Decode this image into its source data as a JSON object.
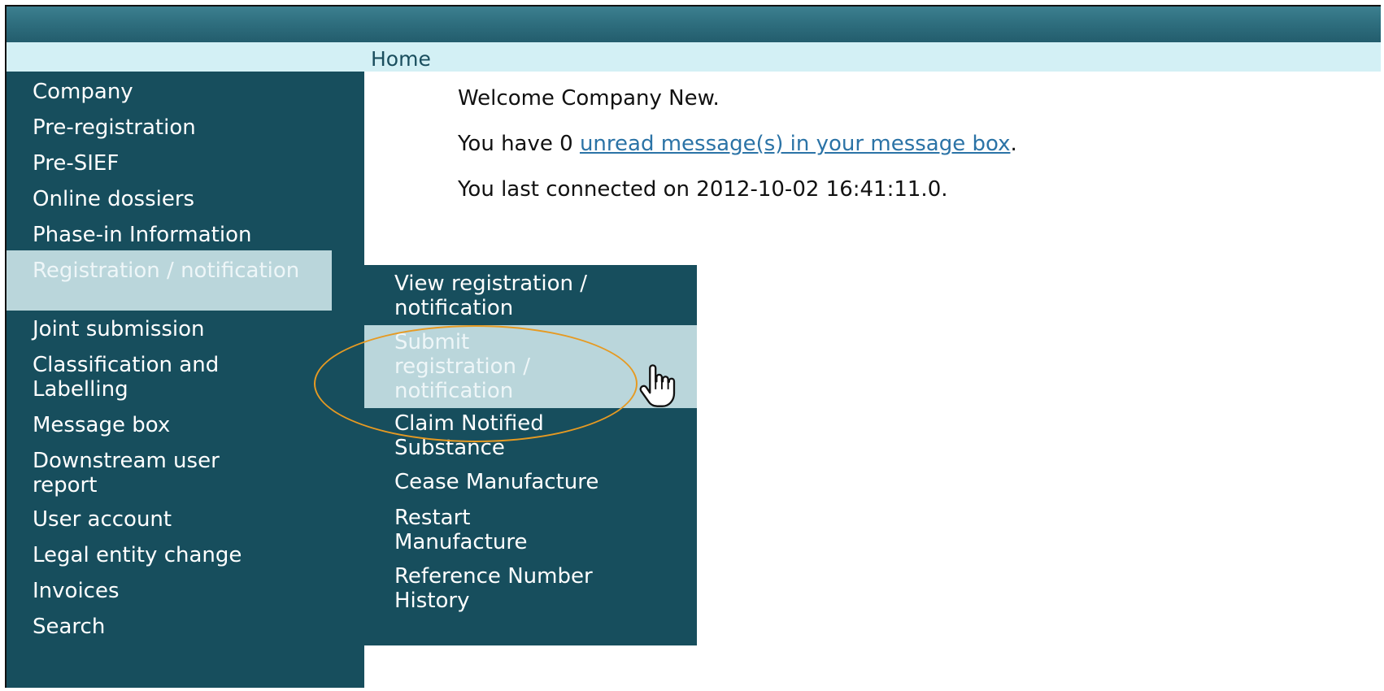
{
  "breadcrumb": {
    "label": "Home"
  },
  "sidebar": {
    "items": [
      {
        "label": "Company"
      },
      {
        "label": "Pre-registration"
      },
      {
        "label": "Pre-SIEF"
      },
      {
        "label": "Online dossiers"
      },
      {
        "label": "Phase-in Information"
      },
      {
        "label": "Registration / notification",
        "active": true
      },
      {
        "label": "Joint submission"
      },
      {
        "label": "Classification and Labelling"
      },
      {
        "label": "Message box"
      },
      {
        "label": "Downstream user report"
      },
      {
        "label": "User account"
      },
      {
        "label": "Legal entity change"
      },
      {
        "label": "Invoices"
      },
      {
        "label": "Search"
      }
    ]
  },
  "submenu": {
    "items": [
      {
        "label": "View registration / notification"
      },
      {
        "label": "Submit registration / notification",
        "active": true
      },
      {
        "label": "Claim Notified Substance"
      },
      {
        "label": "Cease Manufacture"
      },
      {
        "label": "Restart Manufacture"
      },
      {
        "label": "Reference Number History"
      }
    ]
  },
  "main": {
    "welcome": "Welcome Company New.",
    "messages_prefix": "You have 0",
    "messages_link": "unread message(s) in your message box",
    "messages_suffix": ".",
    "last_connected": "You last connected on 2012-10-02 16:41:11.0."
  },
  "colors": {
    "topbar": "#2f6f7f",
    "breadcrumb_bg": "#d3f0f5",
    "sidebar_bg": "#174e5d",
    "active_bg": "#bad6db",
    "link": "#2b73a6",
    "highlight_ring": "#e69a22"
  },
  "icons": {
    "cursor": "hand-pointer-icon"
  }
}
